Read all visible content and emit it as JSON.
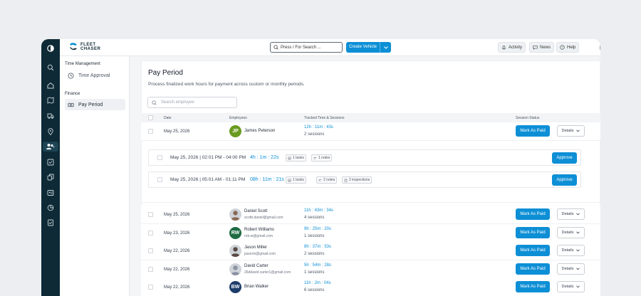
{
  "brand": {
    "line1": "FLEET",
    "line2": "CHASER"
  },
  "topbar": {
    "search_placeholder": "Press / For Search ...",
    "create_label": "Create Vehicle",
    "activity_label": "Activity",
    "news_label": "News",
    "help_label": "Help"
  },
  "sidebar": {
    "section1": "Time Management",
    "item1": "Time Approval",
    "section2": "Finance",
    "item2": "Pay Period"
  },
  "page": {
    "title": "Pay Period",
    "subtitle": "Process finalized work hours for payment across custom or monthly periods.",
    "search_placeholder": "Search employee"
  },
  "columns": {
    "date": "Date",
    "employees": "Employees",
    "tracked": "Tracked Time & Sessions",
    "status": "Session Status"
  },
  "labels": {
    "mark_paid": "Mark As Paid",
    "details": "Details",
    "approve": "Approve"
  },
  "expanded_row": {
    "date": "May 25, 2026",
    "initials": "JP",
    "name": "James Peterson",
    "time": "12h : 11m : 43s",
    "sessions": "2 sessions"
  },
  "sessions": [
    {
      "datetime": "May 25, 2026 | 02:01 PM - 04:00 PM",
      "time": "4h : 1m : 22s",
      "tasks": "1 tasks",
      "notes": "1 notes",
      "inspections": ""
    },
    {
      "datetime": "May 25, 2026 | 05:01 AM - 01:11 PM",
      "time": "08h : 11m : 21s",
      "tasks": "1 tasks",
      "notes": "2 notes",
      "inspections": "2 inspections"
    }
  ],
  "rows": [
    {
      "date": "May 25, 2026",
      "initials": "",
      "name": "Daniel Scott",
      "email": "scottt.daniel@gmail.com",
      "time": "11h : 43m : 34s",
      "sessions": "4 sessions",
      "color": "#8a6a55"
    },
    {
      "date": "May 23, 2026",
      "initials": "RW",
      "name": "Robert Williams",
      "email": "rob.w@gmail.com",
      "time": "9h : 25m : 20s",
      "sessions": "1 sessions",
      "color": "#1f6b43"
    },
    {
      "date": "May 22, 2026",
      "initials": "",
      "name": "Jason Miller",
      "email": "jasonm@gmail.com",
      "time": "8h : 37m : 53s",
      "sessions": "2 sessions",
      "color": "#5a4a44"
    },
    {
      "date": "May 22, 2026",
      "initials": "",
      "name": "David Carter",
      "email": "26ddavid.carter1@gmail.com",
      "time": "5h : 54m : 28s",
      "sessions": "1 sessions",
      "color": "#8b93a3"
    },
    {
      "date": "May 22, 2026",
      "initials": "BW",
      "name": "Brian Walker",
      "email": "",
      "time": "11h : 2m : 04s",
      "sessions": "6 sessions",
      "color": "#1e3d6b"
    }
  ],
  "colors": {
    "accent": "#0d8fd6",
    "rail": "#0e2a36",
    "jp_avatar": "#6a9a1f"
  }
}
